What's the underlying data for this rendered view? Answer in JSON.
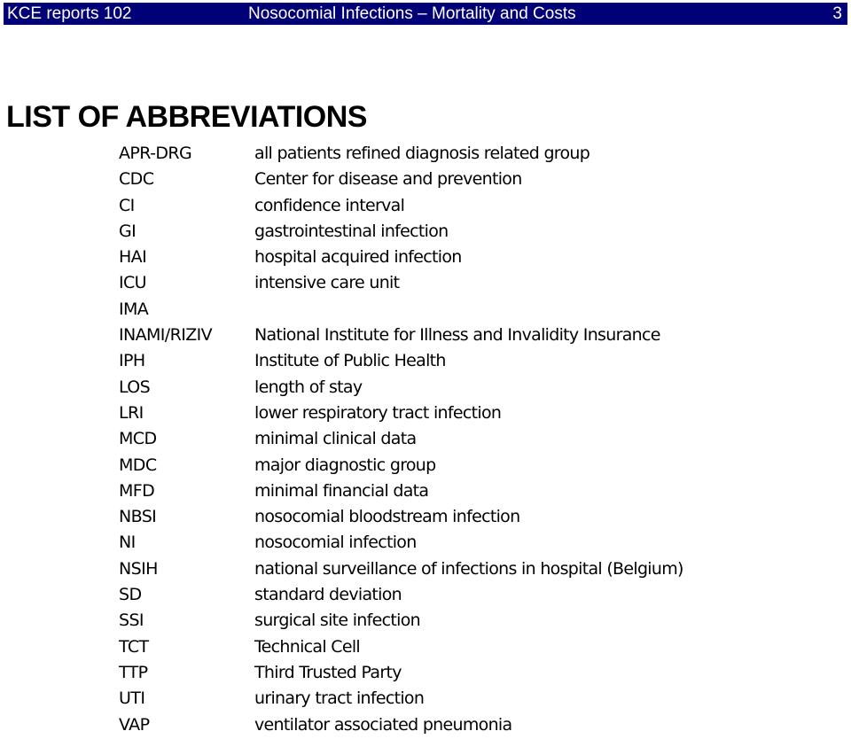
{
  "header": {
    "report": "KCE reports 102",
    "title": "Nosocomial Infections – Mortality and Costs",
    "page_number": "3",
    "bar_color": "#020076"
  },
  "section_title": "LIST OF ABBREVIATIONS",
  "abbreviations": [
    {
      "term": "APR-DRG",
      "definition": "all patients refined diagnosis related group"
    },
    {
      "term": "CDC",
      "definition": "Center for disease and prevention"
    },
    {
      "term": "CI",
      "definition": "confidence interval"
    },
    {
      "term": "GI",
      "definition": "gastrointestinal infection"
    },
    {
      "term": "HAI",
      "definition": "hospital acquired infection"
    },
    {
      "term": "ICU",
      "definition": "intensive care unit"
    },
    {
      "term": "IMA",
      "definition": ""
    },
    {
      "term": "INAMI/RIZIV",
      "definition": "National Institute for Illness and Invalidity Insurance"
    },
    {
      "term": "IPH",
      "definition": "Institute of Public Health"
    },
    {
      "term": "LOS",
      "definition": "length of stay"
    },
    {
      "term": "LRI",
      "definition": "lower respiratory tract infection"
    },
    {
      "term": "MCD",
      "definition": "minimal clinical data"
    },
    {
      "term": "MDC",
      "definition": "major diagnostic group"
    },
    {
      "term": "MFD",
      "definition": "minimal financial data"
    },
    {
      "term": "NBSI",
      "definition": "nosocomial bloodstream infection"
    },
    {
      "term": "NI",
      "definition": "nosocomial infection"
    },
    {
      "term": "NSIH",
      "definition": "national surveillance of infections in hospital (Belgium)"
    },
    {
      "term": "SD",
      "definition": "standard deviation"
    },
    {
      "term": "SSI",
      "definition": "surgical site infection"
    },
    {
      "term": "TCT",
      "definition": "Technical Cell"
    },
    {
      "term": "TTP",
      "definition": "Third Trusted Party"
    },
    {
      "term": "UTI",
      "definition": "urinary tract infection"
    },
    {
      "term": "VAP",
      "definition": "ventilator associated pneumonia"
    }
  ]
}
